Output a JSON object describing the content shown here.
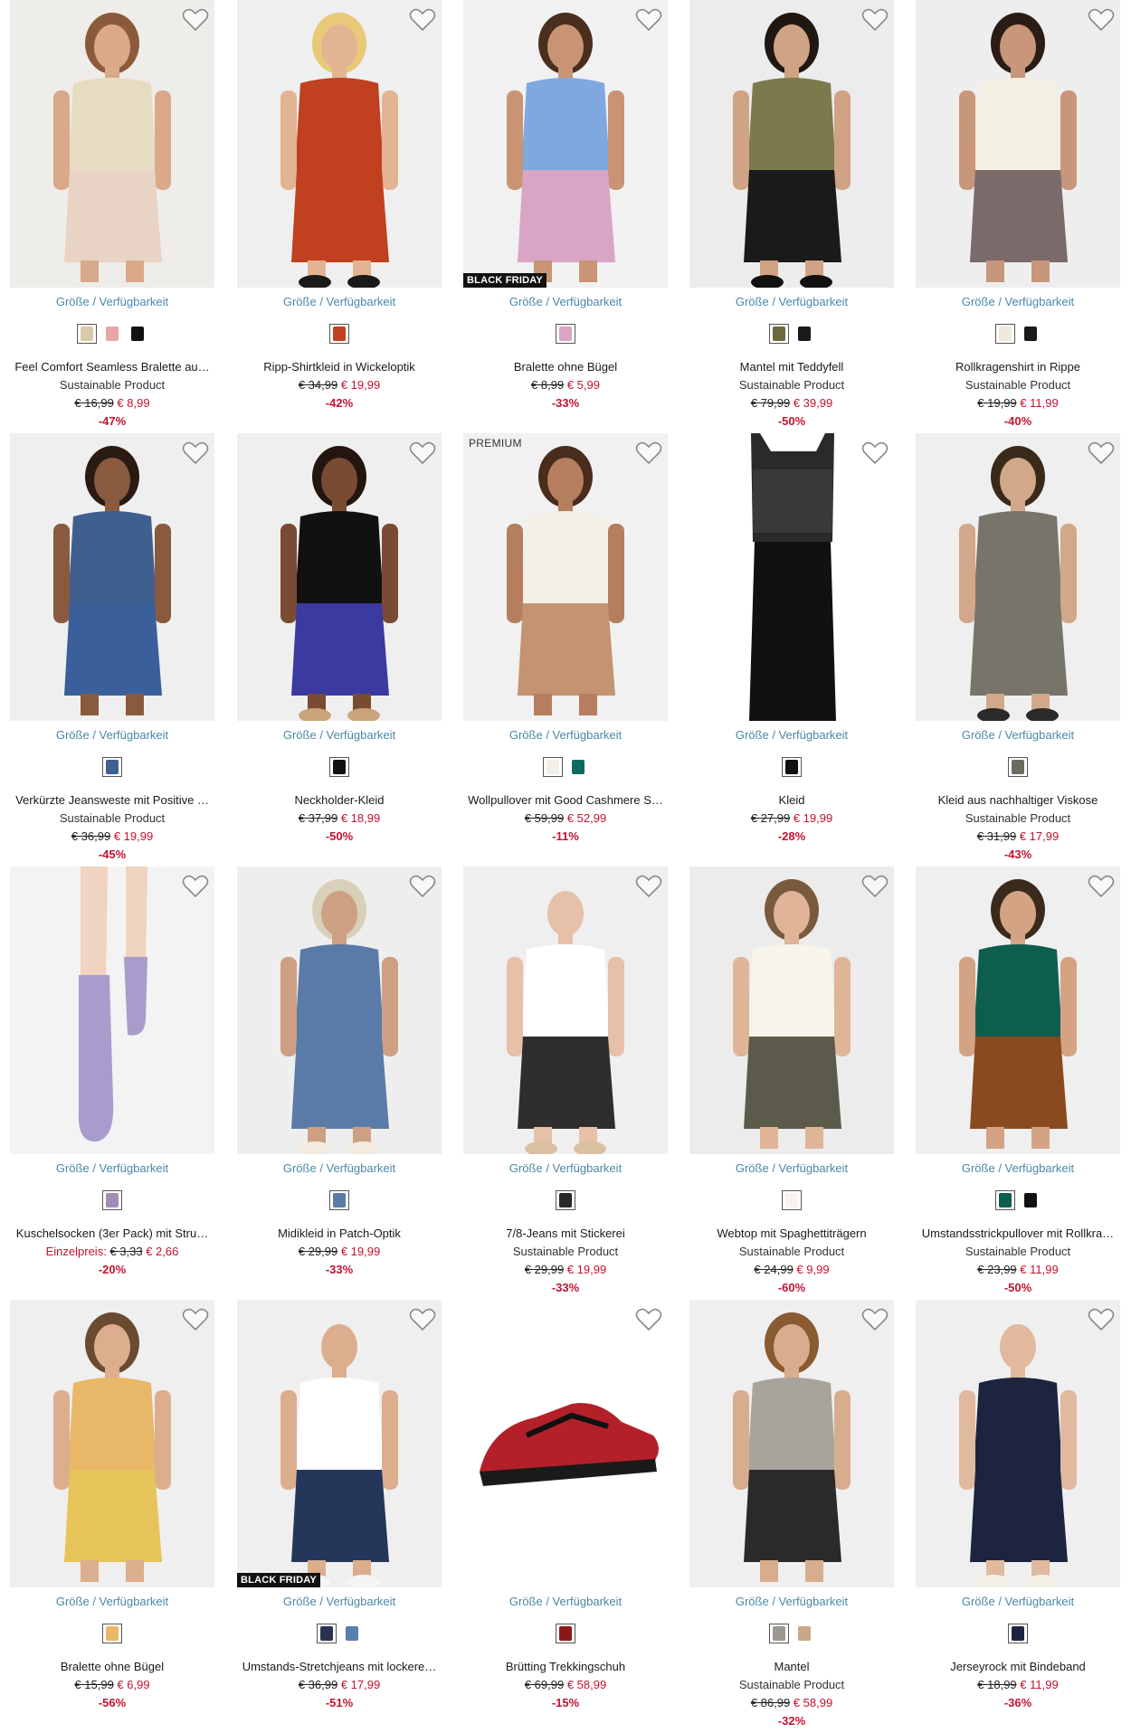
{
  "availability_label": "Größe / Verfügbarkeit",
  "colors": {
    "accent_price": "#c4122f",
    "link": "#4a87a8",
    "badge_bg": "#111111"
  },
  "products": [
    {
      "name": "Feel Comfort Seamless Bralette au…",
      "subtitle": "Sustainable Product",
      "old_price": "€ 16,99",
      "new_price": "€ 8,99",
      "discount": "-47%",
      "badge": "",
      "swatches": [
        "#d9c9a8",
        "#e9a5a5",
        "#111111"
      ],
      "image": {
        "bg": "#efedea",
        "top": "#e6dcc1",
        "bottom": "#e9d3c4",
        "skin": "#d9a98a",
        "hair": "#8a5a3a",
        "shoe": ""
      }
    },
    {
      "name": "Ripp-Shirtkleid in Wickeloptik",
      "subtitle": "",
      "old_price": "€ 34,99",
      "new_price": "€ 19,99",
      "discount": "-42%",
      "badge": "",
      "swatches": [
        "#c0401f"
      ],
      "image": {
        "bg": "#efefef",
        "top": "#c0401f",
        "bottom": "#c0401f",
        "skin": "#e3b493",
        "hair": "#e8c978",
        "shoe": "#1a1a1a"
      }
    },
    {
      "name": "Bralette ohne Bügel",
      "subtitle": "",
      "old_price": "€ 8,99",
      "new_price": "€ 5,99",
      "discount": "-33%",
      "badge": "BLACK FRIDAY",
      "swatches": [
        "#d8a5c4"
      ],
      "image": {
        "bg": "#f1f1f1",
        "top": "#7fa8e0",
        "bottom": "#d8a5c4",
        "skin": "#c99473",
        "hair": "#4a2e1e",
        "shoe": ""
      }
    },
    {
      "name": "Mantel mit Teddyfell",
      "subtitle": "Sustainable Product",
      "old_price": "€ 79,99",
      "new_price": "€ 39,99",
      "discount": "-50%",
      "badge": "",
      "swatches": [
        "#6b6a3e",
        "#1a1a1a"
      ],
      "image": {
        "bg": "#ececec",
        "top": "#7a7a4c",
        "bottom": "#1a1a1a",
        "skin": "#d0a385",
        "hair": "#1f1712",
        "shoe": "#111111"
      }
    },
    {
      "name": "Rollkragenshirt in Rippe",
      "subtitle": "Sustainable Product",
      "old_price": "€ 19,99",
      "new_price": "€ 11,99",
      "discount": "-40%",
      "badge": "",
      "swatches": [
        "#efe9dc",
        "#1a1a1a"
      ],
      "image": {
        "bg": "#eeeeee",
        "top": "#f3efe2",
        "bottom": "#7a6a6a",
        "skin": "#c8967a",
        "hair": "#2a1d16",
        "shoe": ""
      }
    },
    {
      "name": "Verkürzte Jeansweste mit Positive …",
      "subtitle": "Sustainable Product",
      "old_price": "€ 36,99",
      "new_price": "€ 19,99",
      "discount": "-45%",
      "badge": "",
      "swatches": [
        "#3f5f8f"
      ],
      "image": {
        "bg": "#efefef",
        "top": "#3f5f8f",
        "bottom": "#3a5f9a",
        "skin": "#8a5a3f",
        "hair": "#2a1a12",
        "shoe": ""
      }
    },
    {
      "name": "Neckholder-Kleid",
      "subtitle": "",
      "old_price": "€ 37,99",
      "new_price": "€ 18,99",
      "discount": "-50%",
      "badge": "",
      "swatches": [
        "#111111"
      ],
      "image": {
        "bg": "#efefef",
        "top": "#111111",
        "bottom": "#3a3aa0",
        "skin": "#7a4b33",
        "hair": "#231510",
        "shoe": "#c9a47a"
      }
    },
    {
      "name": "Wollpullover mit Good Cashmere S…",
      "subtitle": "",
      "old_price": "€ 59,99",
      "new_price": "€ 52,99",
      "discount": "-11%",
      "badge": "PREMIUM",
      "swatches": [
        "#f2efe6",
        "#0e6a5e"
      ],
      "image": {
        "bg": "#f1f1f1",
        "top": "#f3f0e8",
        "bottom": "#c49372",
        "skin": "#b57e5e",
        "hair": "#4a2c1c",
        "shoe": ""
      }
    },
    {
      "name": "Kleid",
      "subtitle": "",
      "old_price": "€ 27,99",
      "new_price": "€ 19,99",
      "discount": "-28%",
      "badge": "",
      "swatches": [
        "#111111"
      ],
      "image": {
        "bg": "#ffffff",
        "top": "#2a2a2a",
        "bottom": "#111111",
        "skin": "",
        "hair": "",
        "shoe": ""
      }
    },
    {
      "name": "Kleid aus nachhaltiger Viskose",
      "subtitle": "Sustainable Product",
      "old_price": "€ 31,99",
      "new_price": "€ 17,99",
      "discount": "-43%",
      "badge": "",
      "swatches": [
        "#6b6b60"
      ],
      "image": {
        "bg": "#efefef",
        "top": "#77756a",
        "bottom": "#77756a",
        "skin": "#d2a88a",
        "hair": "#3a2a1a",
        "shoe": "#2a2a2a"
      }
    },
    {
      "name": "Kuschelsocken (3er Pack) mit Stru…",
      "subtitle": "",
      "old_price": "€ 3,33",
      "new_price": "€ 2,66",
      "discount": "-20%",
      "badge": "",
      "price_prefix": "Einzelpreis:",
      "swatches": [
        "#9d8fb5"
      ],
      "image": {
        "bg": "#f3f3f3",
        "top": "#f0d3c0",
        "bottom": "#a99ccc",
        "skin": "#f0d3c0",
        "hair": "",
        "shoe": ""
      }
    },
    {
      "name": "Midikleid in Patch-Optik",
      "subtitle": "",
      "old_price": "€ 29,99",
      "new_price": "€ 19,99",
      "discount": "-33%",
      "badge": "",
      "swatches": [
        "#5a7aa8"
      ],
      "image": {
        "bg": "#eeeeee",
        "top": "#5a7aa8",
        "bottom": "#5a7aa8",
        "skin": "#cda083",
        "hair": "#d8d0b8",
        "shoe": "#f2ece0"
      }
    },
    {
      "name": "7/8-Jeans mit Stickerei",
      "subtitle": "Sustainable Product",
      "old_price": "€ 29,99",
      "new_price": "€ 19,99",
      "discount": "-33%",
      "badge": "",
      "swatches": [
        "#2a2a2a"
      ],
      "image": {
        "bg": "#efefef",
        "top": "#ffffff",
        "bottom": "#2e2e2e",
        "skin": "#e6c0a8",
        "hair": "",
        "shoe": "#d9c0a0"
      }
    },
    {
      "name": "Webtop mit Spaghettiträgern",
      "subtitle": "Sustainable Product",
      "old_price": "€ 24,99",
      "new_price": "€ 9,99",
      "discount": "-60%",
      "badge": "",
      "swatches": [
        "#f7f4ec"
      ],
      "image": {
        "bg": "#ececec",
        "top": "#f7f4ec",
        "bottom": "#5c5a4a",
        "skin": "#e0b597",
        "hair": "#7a5a3e",
        "shoe": ""
      }
    },
    {
      "name": "Umstandsstrickpullover mit Rollkra…",
      "subtitle": "Sustainable Product",
      "old_price": "€ 23,99",
      "new_price": "€ 11,99",
      "discount": "-50%",
      "badge": "",
      "swatches": [
        "#0e5e4e",
        "#111111"
      ],
      "image": {
        "bg": "#efefef",
        "top": "#0e5e4e",
        "bottom": "#8a4a1f",
        "skin": "#d4a383",
        "hair": "#3a2a1c",
        "shoe": ""
      }
    },
    {
      "name": "Bralette ohne Bügel",
      "subtitle": "",
      "old_price": "€ 15,99",
      "new_price": "€ 6,99",
      "discount": "-56%",
      "badge": "",
      "swatches": [
        "#e9b768"
      ],
      "image": {
        "bg": "#efefef",
        "top": "#e9b768",
        "bottom": "#e7c45a",
        "skin": "#dcae8e",
        "hair": "#6a4a30",
        "shoe": ""
      }
    },
    {
      "name": "Umstands-Stretchjeans mit lockere…",
      "subtitle": "",
      "old_price": "€ 36,99",
      "new_price": "€ 17,99",
      "discount": "-51%",
      "badge": "BLACK FRIDAY",
      "swatches": [
        "#2a3450",
        "#5a7eae"
      ],
      "image": {
        "bg": "#efefef",
        "top": "#ffffff",
        "bottom": "#24365a",
        "skin": "#dcae8e",
        "hair": "",
        "shoe": "#f5f5f5"
      }
    },
    {
      "name": "Brütting Trekkingschuh",
      "subtitle": "",
      "old_price": "€ 69,99",
      "new_price": "€ 58,99",
      "discount": "-15%",
      "badge": "",
      "swatches": [
        "#8a1a1a"
      ],
      "image": {
        "bg": "#ffffff",
        "top": "",
        "bottom": "",
        "skin": "",
        "hair": "",
        "shoe": "#b3202a"
      }
    },
    {
      "name": "Mantel",
      "subtitle": "Sustainable Product",
      "old_price": "€ 86,99",
      "new_price": "€ 58,99",
      "discount": "-32%",
      "badge": "",
      "swatches": [
        "#9a9890",
        "#c8a888"
      ],
      "image": {
        "bg": "#efefef",
        "top": "#a8a49c",
        "bottom": "#2a2a2a",
        "skin": "#d8ad8d",
        "hair": "#8a5a32",
        "shoe": ""
      }
    },
    {
      "name": "Jerseyrock mit Bindeband",
      "subtitle": "",
      "old_price": "€ 18,99",
      "new_price": "€ 11,99",
      "discount": "-36%",
      "badge": "",
      "swatches": [
        "#1d2440"
      ],
      "image": {
        "bg": "#efefef",
        "top": "#1d2440",
        "bottom": "#1d2440",
        "skin": "#e0b99e",
        "hair": "",
        "shoe": "#f3efe6"
      }
    }
  ]
}
